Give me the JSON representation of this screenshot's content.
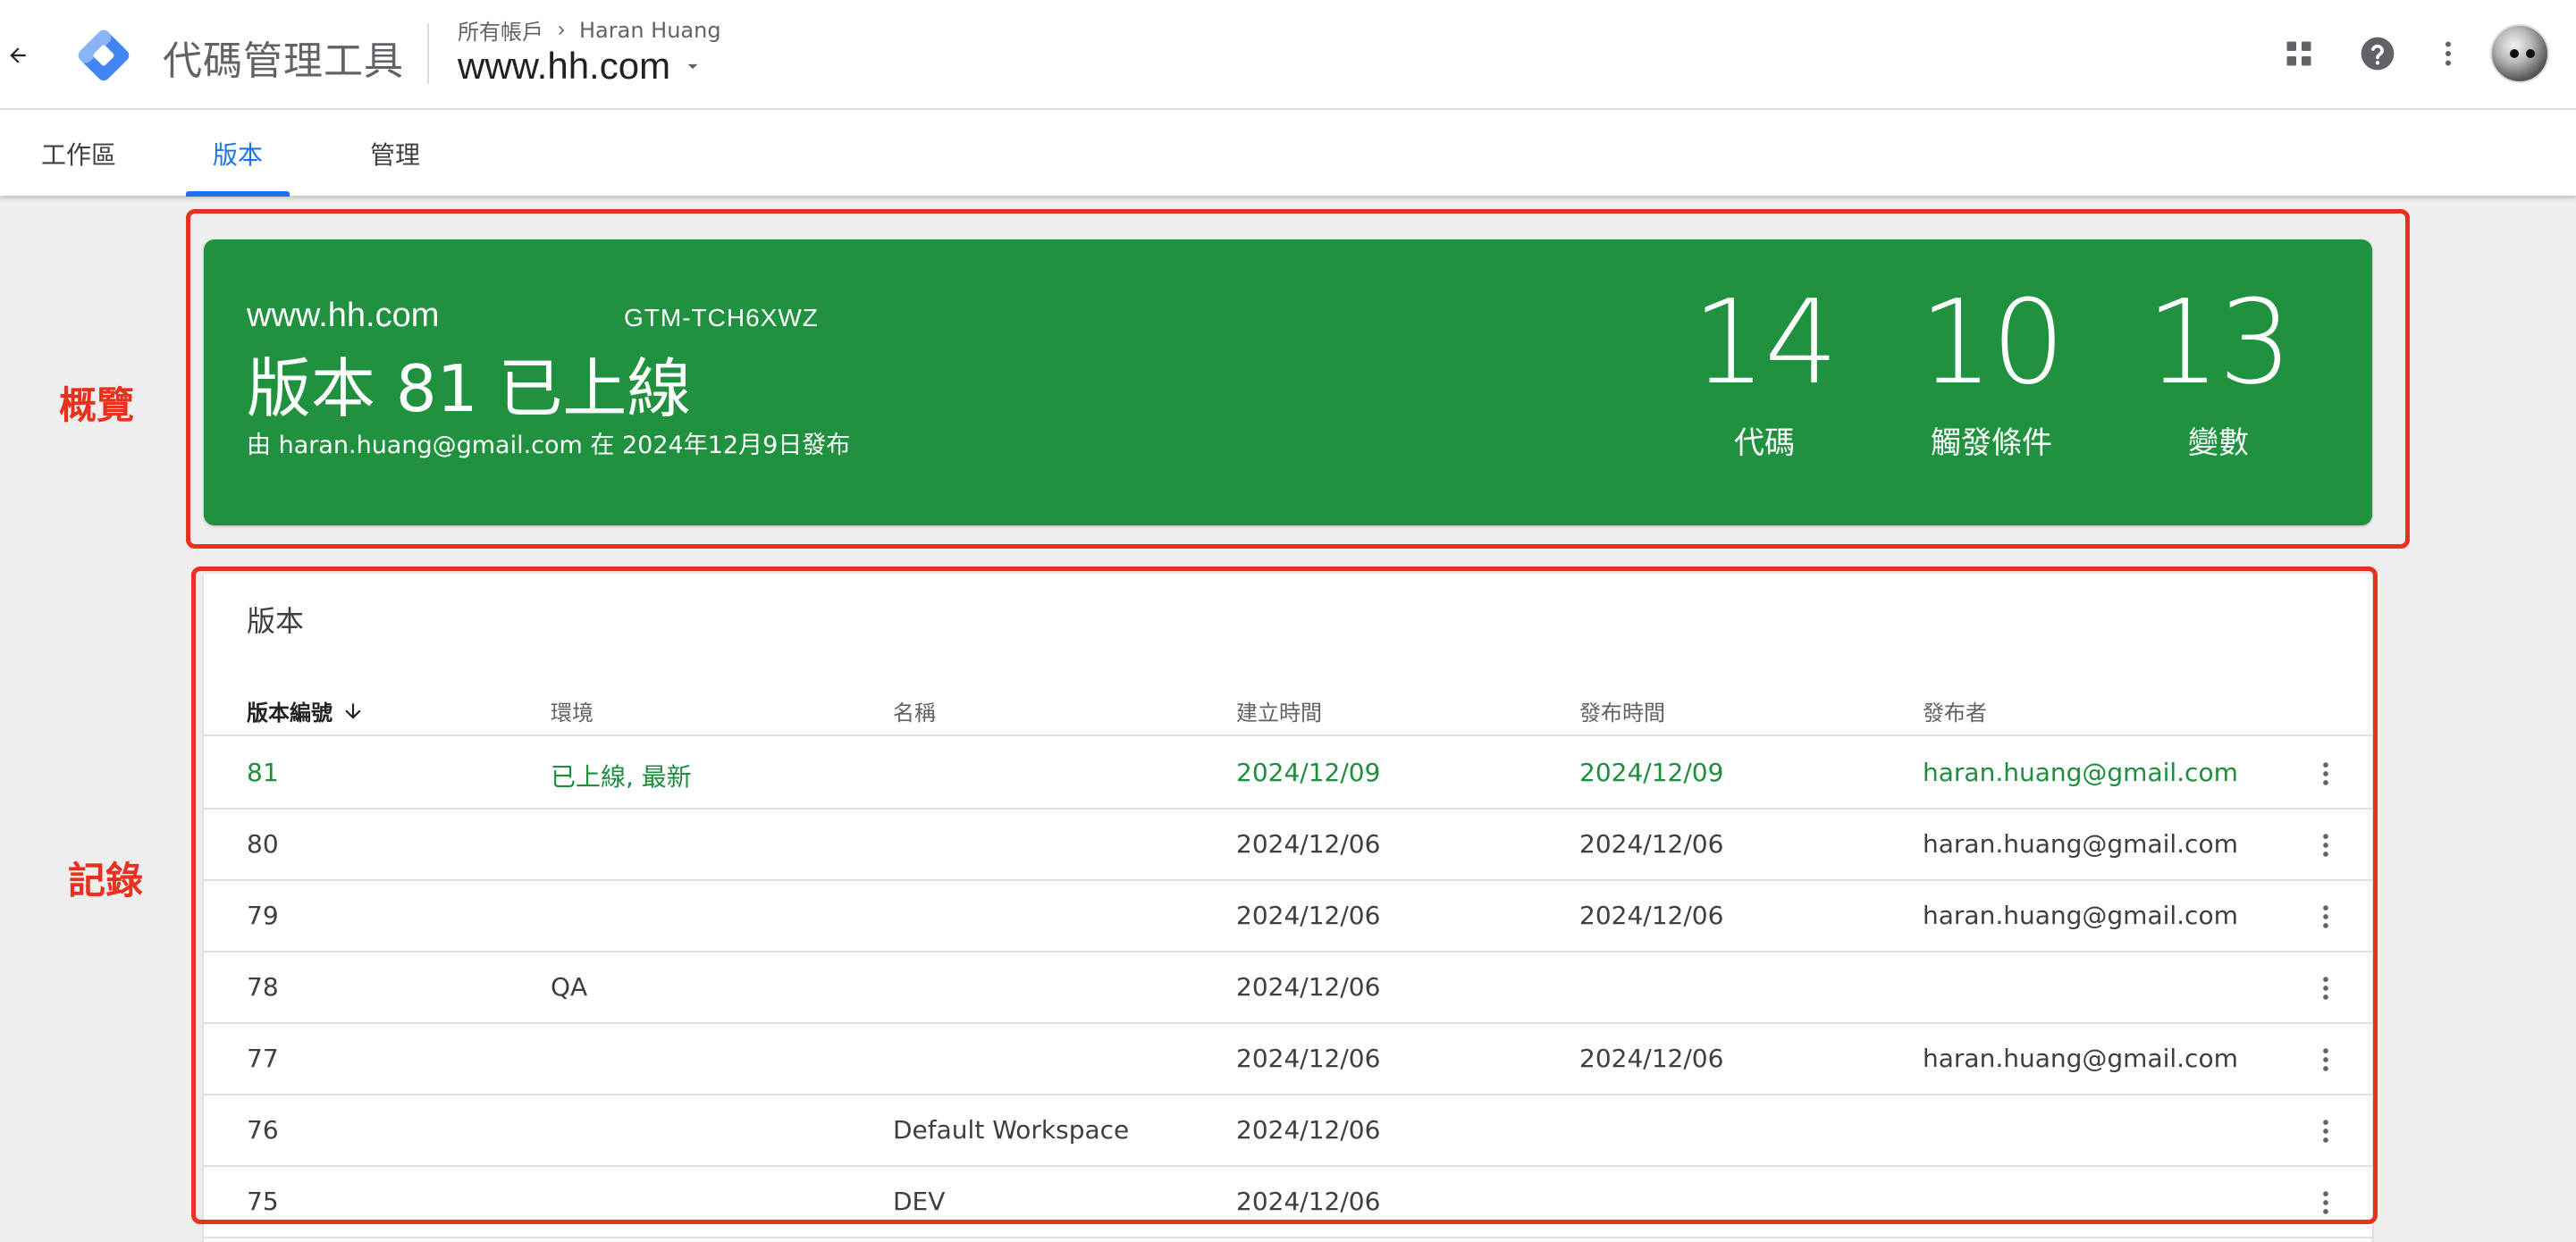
{
  "header": {
    "app_title": "代碼管理工具",
    "breadcrumb_root": "所有帳戶",
    "breadcrumb_account": "Haran Huang",
    "container_name": "www.hh.com"
  },
  "tabs": [
    {
      "label": "工作區"
    },
    {
      "label": "版本"
    },
    {
      "label": "管理"
    }
  ],
  "annotations": {
    "overview": "概覽",
    "records": "記錄"
  },
  "summary": {
    "container": "www.hh.com",
    "container_id": "GTM-TCH6XWZ",
    "title": "版本 81 已上線",
    "published_by": "由 haran.huang@gmail.com 在 2024年12月9日發布",
    "stats": [
      {
        "value": "14",
        "label": "代碼"
      },
      {
        "value": "10",
        "label": "觸發條件"
      },
      {
        "value": "13",
        "label": "變數"
      }
    ]
  },
  "versions": {
    "title": "版本",
    "columns": {
      "id": "版本編號",
      "env": "環境",
      "name": "名稱",
      "created": "建立時間",
      "published": "發布時間",
      "publisher": "發布者"
    },
    "rows": [
      {
        "id": "81",
        "env": "已上線, 最新",
        "name": "",
        "created": "2024/12/09",
        "published": "2024/12/09",
        "publisher": "haran.huang@gmail.com"
      },
      {
        "id": "80",
        "env": "",
        "name": "",
        "created": "2024/12/06",
        "published": "2024/12/06",
        "publisher": "haran.huang@gmail.com"
      },
      {
        "id": "79",
        "env": "",
        "name": "",
        "created": "2024/12/06",
        "published": "2024/12/06",
        "publisher": "haran.huang@gmail.com"
      },
      {
        "id": "78",
        "env": "QA",
        "name": "",
        "created": "2024/12/06",
        "published": "",
        "publisher": ""
      },
      {
        "id": "77",
        "env": "",
        "name": "",
        "created": "2024/12/06",
        "published": "2024/12/06",
        "publisher": "haran.huang@gmail.com"
      },
      {
        "id": "76",
        "env": "",
        "name": "Default Workspace",
        "created": "2024/12/06",
        "published": "",
        "publisher": ""
      },
      {
        "id": "75",
        "env": "",
        "name": "DEV",
        "created": "2024/12/06",
        "published": "",
        "publisher": ""
      }
    ]
  },
  "icons": {
    "back": "arrow-back-icon",
    "logo": "gtm-logo",
    "apps": "apps-grid-icon",
    "help": "help-icon",
    "more": "more-vert-icon",
    "sort": "arrow-down-icon"
  },
  "colors": {
    "live_green": "#20923f",
    "live_text": "#1e8e3e",
    "accent_blue": "#1a73e8",
    "annotation_red": "#e8321f"
  }
}
